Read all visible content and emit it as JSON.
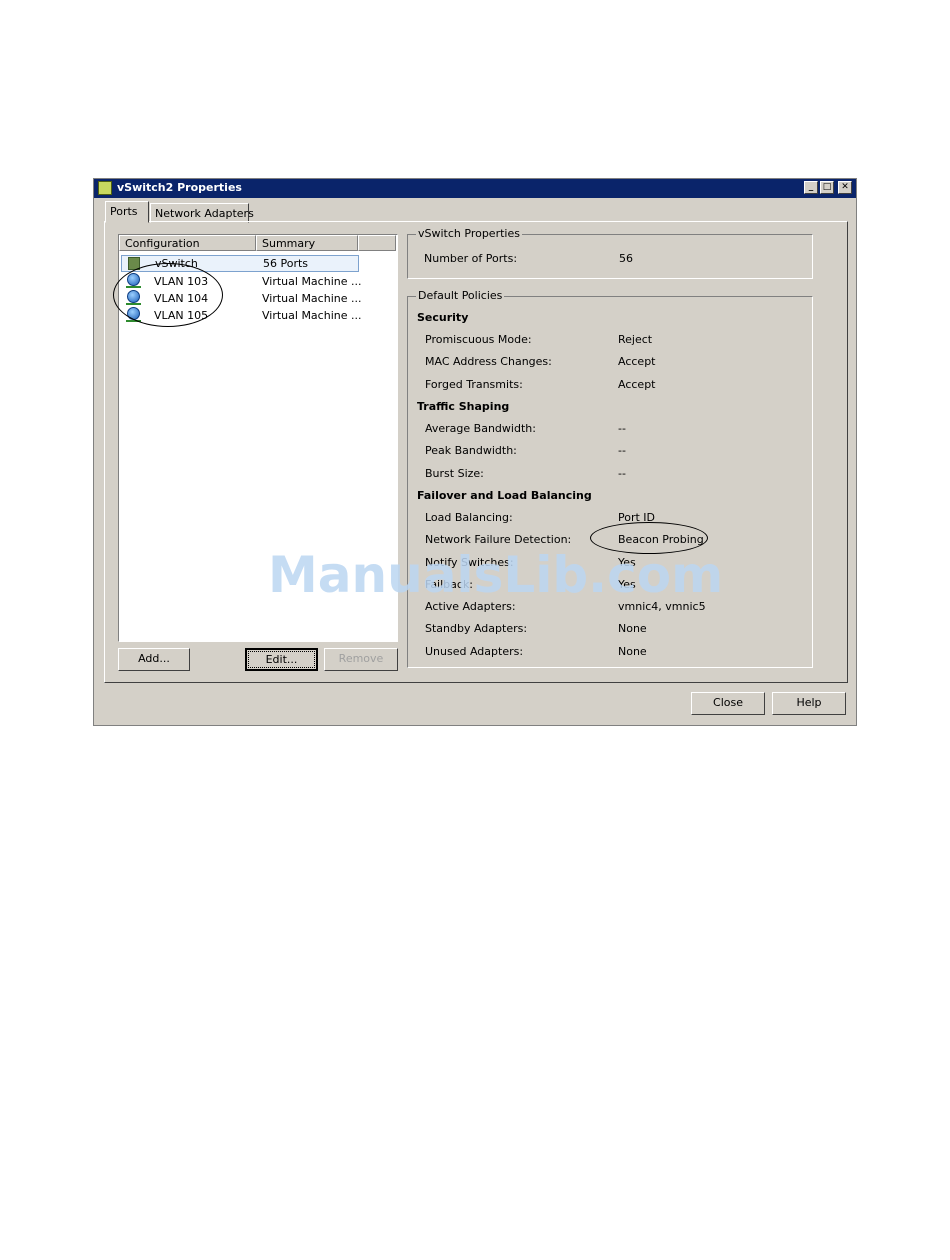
{
  "window": {
    "title": "vSwitch2 Properties"
  },
  "window_controls": {
    "minimize": "_",
    "maximize": "□",
    "close": "✕"
  },
  "tabs": [
    {
      "label": "Ports"
    },
    {
      "label": "Network Adapters"
    }
  ],
  "list": {
    "columns": [
      "Configuration",
      "Summary"
    ],
    "rows": [
      {
        "icon": "vswitch-icon",
        "name": "vSwitch",
        "summary": "56 Ports"
      },
      {
        "icon": "vm-network-icon",
        "name": "VLAN 103",
        "summary": "Virtual Machine ..."
      },
      {
        "icon": "vm-network-icon",
        "name": "VLAN 104",
        "summary": "Virtual Machine ..."
      },
      {
        "icon": "vm-network-icon",
        "name": "VLAN 105",
        "summary": "Virtual Machine ..."
      }
    ]
  },
  "list_buttons": {
    "add": "Add...",
    "edit": "Edit...",
    "remove": "Remove"
  },
  "vswitch_properties": {
    "title": "vSwitch Properties",
    "ports_label": "Number of Ports:",
    "ports_value": "56"
  },
  "default_policies": {
    "title": "Default Policies",
    "security": {
      "heading": "Security",
      "items": [
        {
          "label": "Promiscuous Mode:",
          "value": "Reject"
        },
        {
          "label": "MAC Address Changes:",
          "value": "Accept"
        },
        {
          "label": "Forged Transmits:",
          "value": "Accept"
        }
      ]
    },
    "traffic_shaping": {
      "heading": "Traffic Shaping",
      "items": [
        {
          "label": "Average Bandwidth:",
          "value": "--"
        },
        {
          "label": "Peak Bandwidth:",
          "value": "--"
        },
        {
          "label": "Burst Size:",
          "value": "--"
        }
      ]
    },
    "failover": {
      "heading": "Failover and Load Balancing",
      "items": [
        {
          "label": "Load Balancing:",
          "value": "Port ID"
        },
        {
          "label": "Network Failure Detection:",
          "value": "Beacon Probing"
        },
        {
          "label": "Notify Switches:",
          "value": "Yes"
        },
        {
          "label": "Failback:",
          "value": "Yes"
        },
        {
          "label": "Active Adapters:",
          "value": "vmnic4, vmnic5"
        },
        {
          "label": "Standby Adapters:",
          "value": "None"
        },
        {
          "label": "Unused Adapters:",
          "value": "None"
        }
      ]
    }
  },
  "dialog_buttons": {
    "close": "Close",
    "help": "Help"
  },
  "watermark": "ManualsLib.com",
  "colors": {
    "titlebar": "#0a246a",
    "dialog_bg": "#d4d0c8",
    "selection": "#7da2ce"
  }
}
